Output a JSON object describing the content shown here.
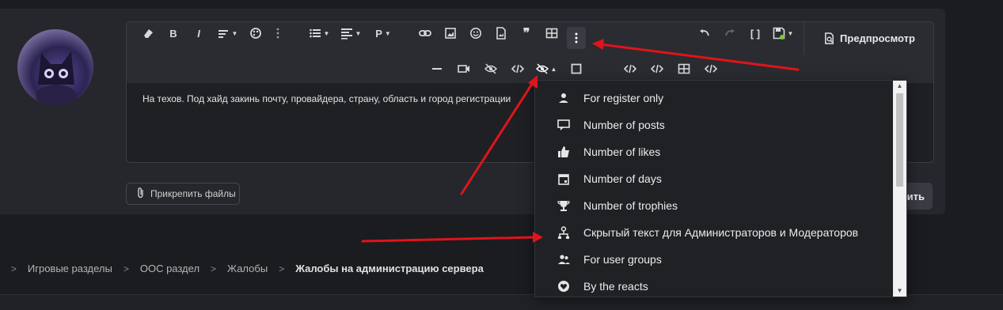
{
  "editor": {
    "content_text": "На техов. Под хайд закинь почту, провайдера, страну, область и город регистрации",
    "preview_label": "Предпросмотр"
  },
  "attach_label": "Прикрепить файлы",
  "submit_label": "ить",
  "breadcrumb": {
    "items": [
      "Игровые разделы",
      "ООС раздел",
      "Жалобы"
    ],
    "current": "Жалобы на администрацию сервера",
    "separator": ">"
  },
  "dropdown": {
    "items": [
      {
        "label": "For register only",
        "icon": "user-icon"
      },
      {
        "label": "Number of posts",
        "icon": "posts-icon"
      },
      {
        "label": "Number of likes",
        "icon": "thumbs-up-icon"
      },
      {
        "label": "Number of days",
        "icon": "calendar-icon"
      },
      {
        "label": "Number of trophies",
        "icon": "trophy-icon"
      },
      {
        "label": "Скрытый текст для Администраторов и Модераторов",
        "icon": "hierarchy-icon"
      },
      {
        "label": "For user groups",
        "icon": "user-group-icon"
      },
      {
        "label": "By the reacts",
        "icon": "heart-icon"
      }
    ]
  },
  "colors": {
    "background": "#1b1c20",
    "panel": "#26272c",
    "annotation_arrow": "#e0141b",
    "save_indicator": "#7cc83a"
  }
}
